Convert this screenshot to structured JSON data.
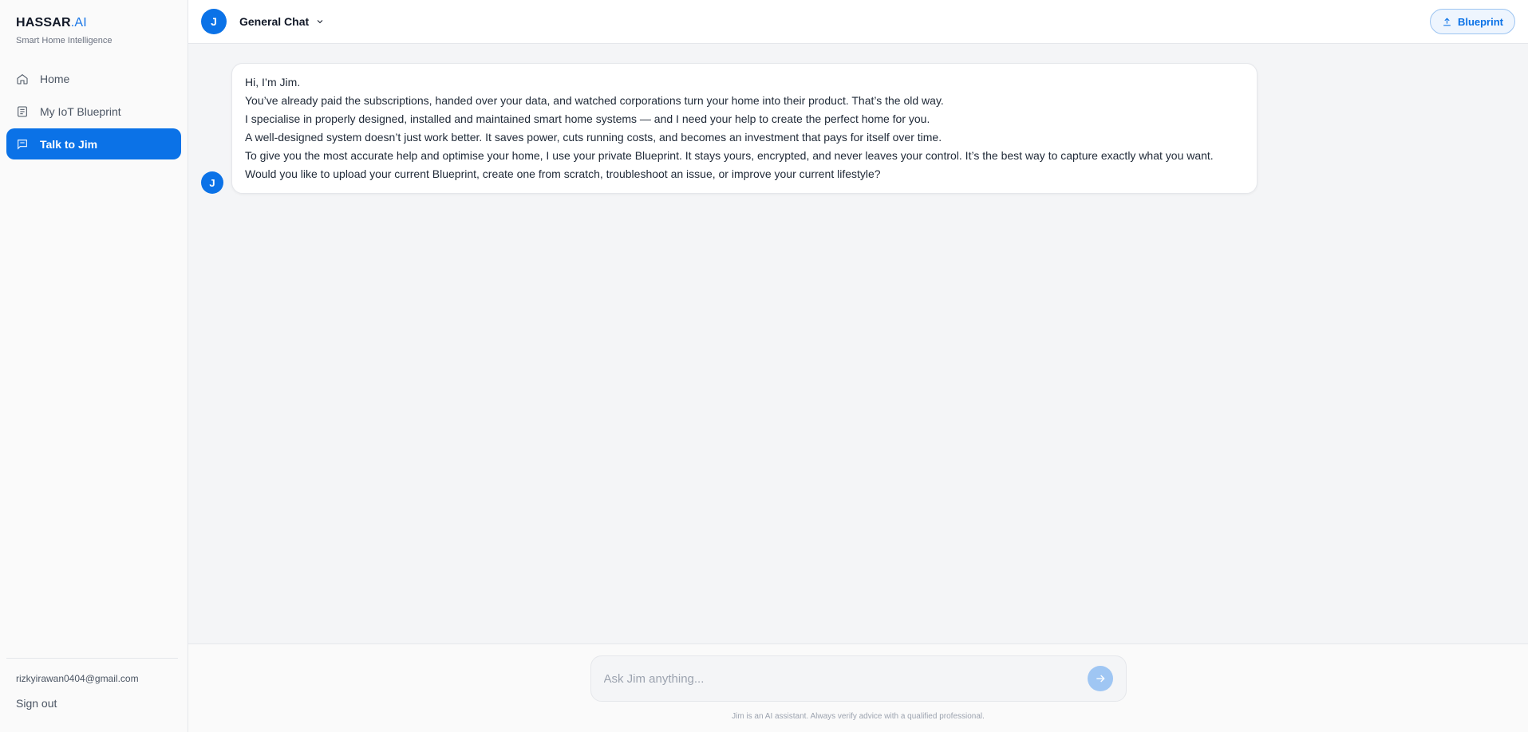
{
  "sidebar": {
    "brand": {
      "name": "HASSAR",
      "suffix": ".AI",
      "tagline": "Smart Home Intelligence"
    },
    "items": [
      {
        "label": "Home",
        "icon": "home-icon"
      },
      {
        "label": "My IoT Blueprint",
        "icon": "document-icon"
      },
      {
        "label": "Talk to Jim",
        "icon": "chat-bubble-icon",
        "active": true
      }
    ],
    "user_email": "rizkyirawan0404@gmail.com",
    "signout_label": "Sign out"
  },
  "header": {
    "avatar_initial": "J",
    "chat_title": "General Chat",
    "blueprint_button": "Blueprint"
  },
  "chat": {
    "messages": [
      {
        "sender_initial": "J",
        "lines": [
          "Hi, I’m Jim.",
          "You’ve already paid the subscriptions, handed over your data, and watched corporations turn your home into their product. That’s the old way.",
          "I specialise in properly designed, installed and maintained smart home systems — and I need your help to create the perfect home for you.",
          "A well-designed system doesn’t just work better. It saves power, cuts running costs, and becomes an investment that pays for itself over time.",
          "To give you the most accurate help and optimise your home, I use your private Blueprint. It stays yours, encrypted, and never leaves your control. It’s the best way to capture exactly what you want.",
          "Would you like to upload your current Blueprint, create one from scratch, troubleshoot an issue, or improve your current lifestyle?"
        ]
      }
    ]
  },
  "composer": {
    "placeholder": "Ask Jim anything...",
    "value": "",
    "disclaimer": "Jim is an AI assistant. Always verify advice with a qualified professional."
  },
  "colors": {
    "accent": "#0b72e7",
    "send_disabled": "#9fc6f3"
  }
}
